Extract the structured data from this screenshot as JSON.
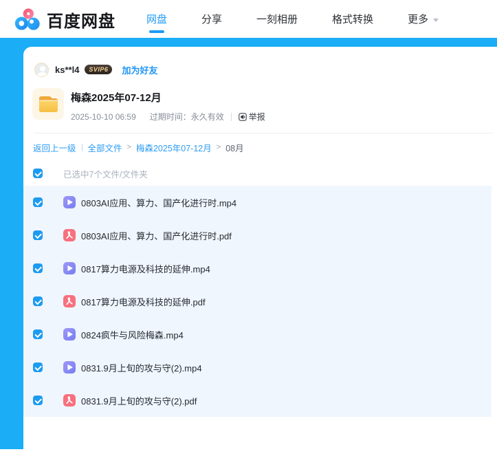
{
  "header": {
    "brand": "百度网盘",
    "tabs": [
      {
        "label": "网盘",
        "active": true
      },
      {
        "label": "分享",
        "active": false
      },
      {
        "label": "一刻相册",
        "active": false
      },
      {
        "label": "格式转换",
        "active": false
      },
      {
        "label": "更多",
        "active": false,
        "has_dropdown": true
      }
    ]
  },
  "share": {
    "user": {
      "name": "ks**l4",
      "vip_badge": "SVIP6",
      "add_friend_label": "加为好友"
    },
    "folder": {
      "name": "梅森2025年07-12月",
      "date": "2025-10-10 06:59",
      "expire": "过期时间：永久有效",
      "report_label": "举报"
    },
    "breadcrumb": {
      "back_label": "返回上一级",
      "items": [
        "全部文件",
        "梅森2025年07-12月",
        "08月"
      ],
      "caret": ">"
    },
    "selection_label": "已选中7个文件/文件夹",
    "files": [
      {
        "name": "0803AI应用、算力、国产化进行时.mp4",
        "type": "video"
      },
      {
        "name": "0803AI应用、算力、国产化进行时.pdf",
        "type": "pdf"
      },
      {
        "name": "0817算力电源及科技的延伸.mp4",
        "type": "video"
      },
      {
        "name": "0817算力电源及科技的延伸.pdf",
        "type": "pdf"
      },
      {
        "name": "0824疯牛与风险梅森.mp4",
        "type": "video"
      },
      {
        "name": "0831.9月上旬的攻与守(2).mp4",
        "type": "video"
      },
      {
        "name": "0831.9月上旬的攻与守(2).pdf",
        "type": "pdf"
      }
    ]
  },
  "colors": {
    "accent_blue": "#1badf5",
    "link_blue": "#2d9cf2",
    "checkbox_blue": "#1d9bf0",
    "video_icon": "#7e80f1",
    "pdf_icon": "#f8707e",
    "folder_yellow": "#f9c84d",
    "vip_gold": "#f4cf8e",
    "selected_row_bg": "#f0f6fd"
  }
}
